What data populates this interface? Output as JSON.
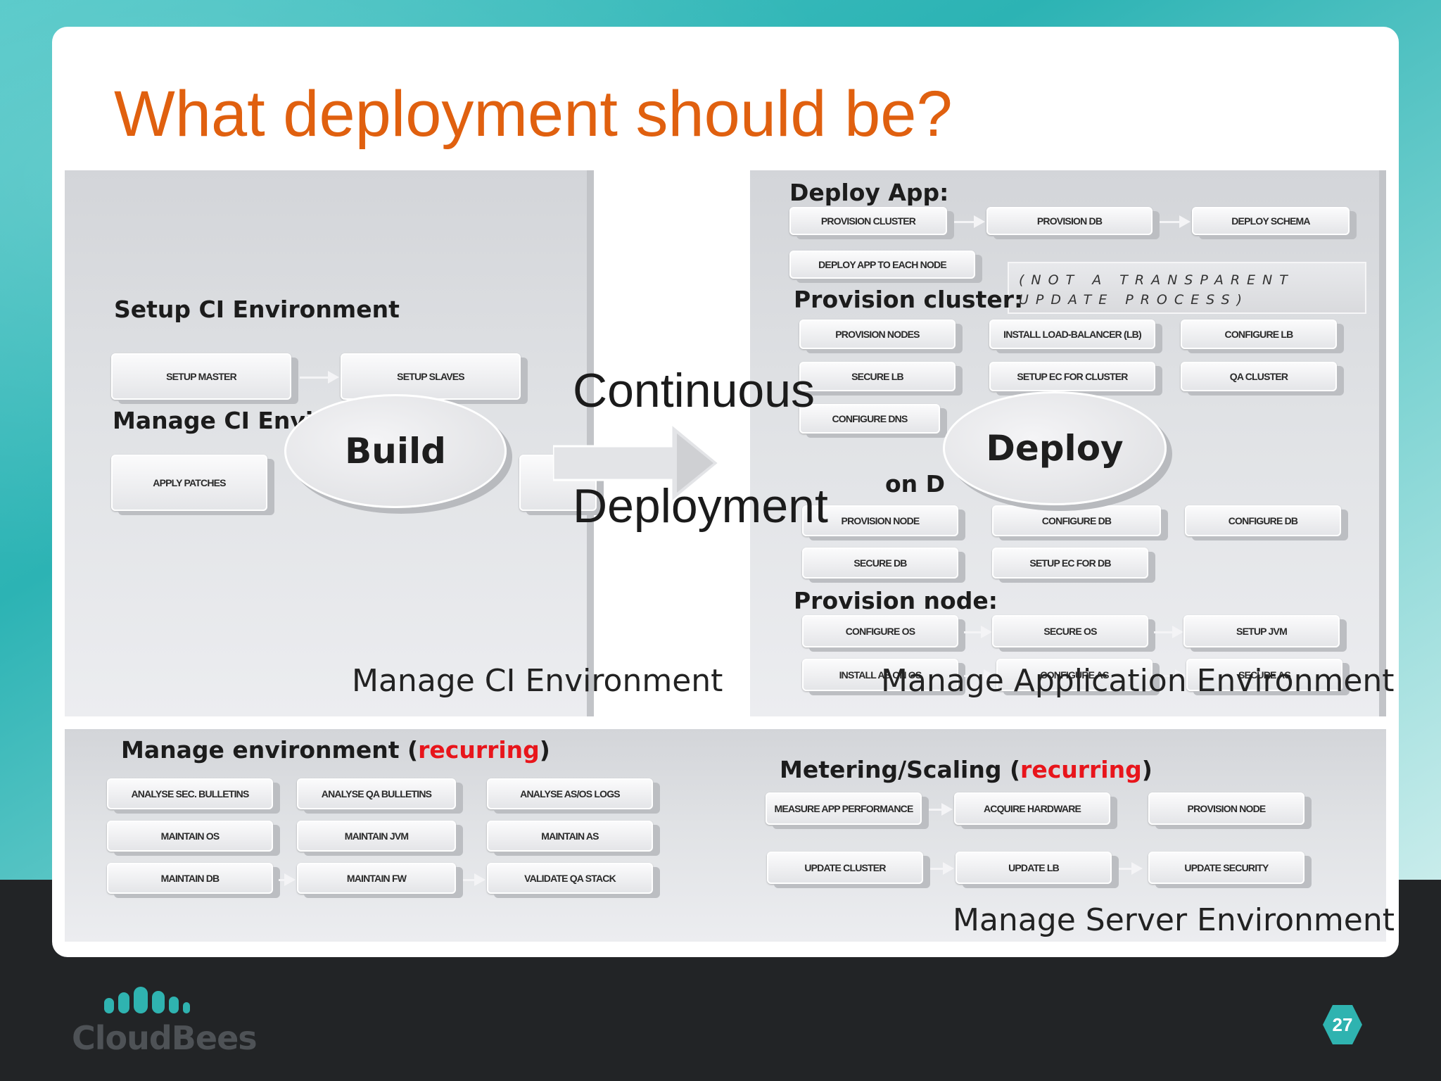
{
  "title": "What deployment should be?",
  "ci_panel": {
    "label": "Manage CI Environment",
    "setup_heading": "Setup CI Environment",
    "setup_boxes": [
      "Setup Master",
      "Setup Slaves"
    ],
    "manage_heading": "Manage CI Environment:",
    "manage_box": "Apply Patches"
  },
  "build_label": "Build",
  "deploy_label": "Deploy",
  "cd_line1": "Continuous",
  "cd_line2": "Deployment",
  "app_panel": {
    "label": "Manage Application Environment",
    "deploy_heading": "Deploy App:",
    "deploy_boxes": [
      "Provision cluster",
      "Provision DB",
      "Deploy schema",
      "Deploy App to each node"
    ],
    "note": "(NOT A TRANSPARENT UPDATE PROCESS)",
    "cluster_heading": "Provision cluster:",
    "cluster_boxes": [
      "Provision nodes",
      "Install load-balancer (LB)",
      "Configure LB",
      "Secure LB",
      "Setup EC for cluster",
      "QA cluster",
      "Configure DNS"
    ],
    "db_heading_fragment": "on D",
    "db_boxes": [
      "Provision node",
      "Configure DB",
      "Configure DB",
      "Secure DB",
      "Setup EC for DB"
    ],
    "node_heading": "Provision node:",
    "node_boxes": [
      "Configure OS",
      "Secure OS",
      "Setup JVM",
      "Install AS on OS",
      "Configure AS",
      "Secure AS"
    ]
  },
  "env_panel": {
    "label": "Manage Server Environment",
    "manage_heading": "Manage environment (",
    "manage_recurring": "recurring",
    "manage_close": ")",
    "manage_boxes": [
      "Analyse sec. bulletins",
      "Analyse QA bulletins",
      "Analyse AS/OS logs",
      "Maintain OS",
      "Maintain JVM",
      "Maintain AS",
      "Maintain DB",
      "Maintain FW",
      "Validate QA stack"
    ],
    "metering_heading": "Metering/Scaling (",
    "metering_recurring": "recurring",
    "metering_close": ")",
    "metering_boxes": [
      "Measure App performance",
      "Acquire Hardware",
      "Provision node",
      "Update Cluster",
      "Update LB",
      "Update Security"
    ]
  },
  "brand": "CloudBees",
  "page_number": "27",
  "colors": {
    "title": "#e0600f",
    "recurring": "#e8151b",
    "accent": "#2fb3b0"
  }
}
